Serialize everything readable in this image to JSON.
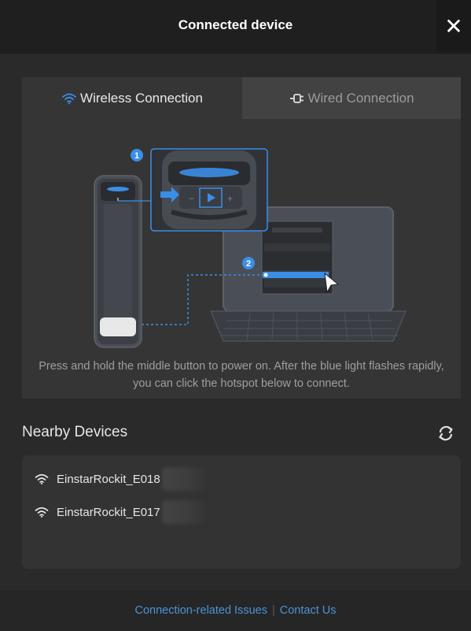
{
  "dialog": {
    "title": "Connected device",
    "close_label": "✕"
  },
  "tabs": [
    {
      "label": "Wireless Connection",
      "icon": "wifi-icon",
      "active": true
    },
    {
      "label": "Wired Connection",
      "icon": "plug-icon",
      "active": false
    }
  ],
  "illustration": {
    "step1": "1",
    "step2": "2"
  },
  "hint": "Press and hold the middle button to power on. After the blue light flashes rapidly, you can click the hotspot below to connect.",
  "nearby": {
    "title": "Nearby Devices",
    "devices": [
      {
        "name": "EinstarRockit_E018"
      },
      {
        "name": "EinstarRockit_E017"
      }
    ]
  },
  "footer": {
    "issues_link": "Connection-related Issues",
    "separator": "|",
    "contact_link": "Contact Us"
  },
  "colors": {
    "accent_blue": "#3a8ee6",
    "link_blue": "#4a94d8",
    "background": "#2a2a2a",
    "card": "#353535"
  }
}
